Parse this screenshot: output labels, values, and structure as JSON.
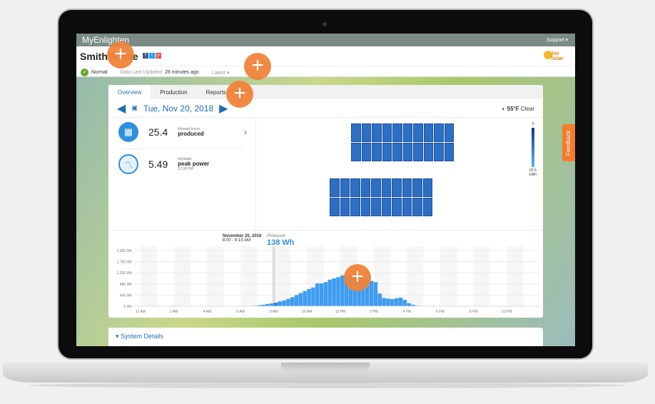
{
  "topbar": {
    "brand": "MyEnlighten",
    "support": "Support"
  },
  "header": {
    "site_name": "Smith Home",
    "social": [
      "f",
      "t",
      "g+"
    ],
    "status": "Normal",
    "last_updated_label": "Data Last Updated",
    "last_updated_value": "28 minutes ago",
    "latest_label": "Latest",
    "logo_text": "Joe Solar"
  },
  "tabs": [
    {
      "label": "Overview",
      "active": true
    },
    {
      "label": "Production"
    },
    {
      "label": "Reports"
    }
  ],
  "date": "Tue, Nov 20, 2018",
  "weather": {
    "temp": "55°F",
    "condition": "Clear"
  },
  "stats": [
    {
      "icon": "solar-panel-icon",
      "value": "25.4",
      "unit": "kilowatt-hours",
      "label": "produced"
    },
    {
      "icon": "power-graph-icon",
      "value": "5.49",
      "unit": "kilowatts",
      "label": "peak power",
      "time": "12:00 PM"
    }
  ],
  "heat_legend": {
    "min": "0",
    "max": "62.5",
    "unit": "kWh"
  },
  "tooltip": {
    "date": "November 20, 2018",
    "range": "8:00 - 8:15 AM",
    "label": "Produced",
    "value": "138 Wh"
  },
  "system_details": "System Details",
  "feedback": "Feedback",
  "colors": {
    "accent": "#1e6fb5",
    "bars": "#3f9cf0",
    "hotspot": "#f0833a"
  },
  "chart_data": {
    "type": "bar",
    "ylabel": "",
    "xlabel": "",
    "ylim": [
      0,
      2200
    ],
    "yticks": [
      "0 Wh",
      "440 Wh",
      "880 Wh",
      "1,320 Wh",
      "1,760 Wh",
      "2,200 Wh"
    ],
    "xticks": [
      "12 AM",
      "2 AM",
      "4 AM",
      "6 AM",
      "8 AM",
      "10 AM",
      "12 PM",
      "2 PM",
      "4 PM",
      "6 PM",
      "8 PM",
      "10 PM"
    ],
    "interval": "15 min",
    "start": "6:45 AM",
    "highlighted": "8:00 AM",
    "values": [
      20,
      40,
      60,
      90,
      110,
      138,
      190,
      230,
      290,
      360,
      440,
      520,
      600,
      680,
      740,
      900,
      900,
      950,
      1050,
      1100,
      1150,
      1220,
      1250,
      1200,
      1150,
      1180,
      1100,
      1080,
      1000,
      950,
      500,
      320,
      300,
      280,
      310,
      340,
      250,
      120,
      60,
      20
    ]
  }
}
